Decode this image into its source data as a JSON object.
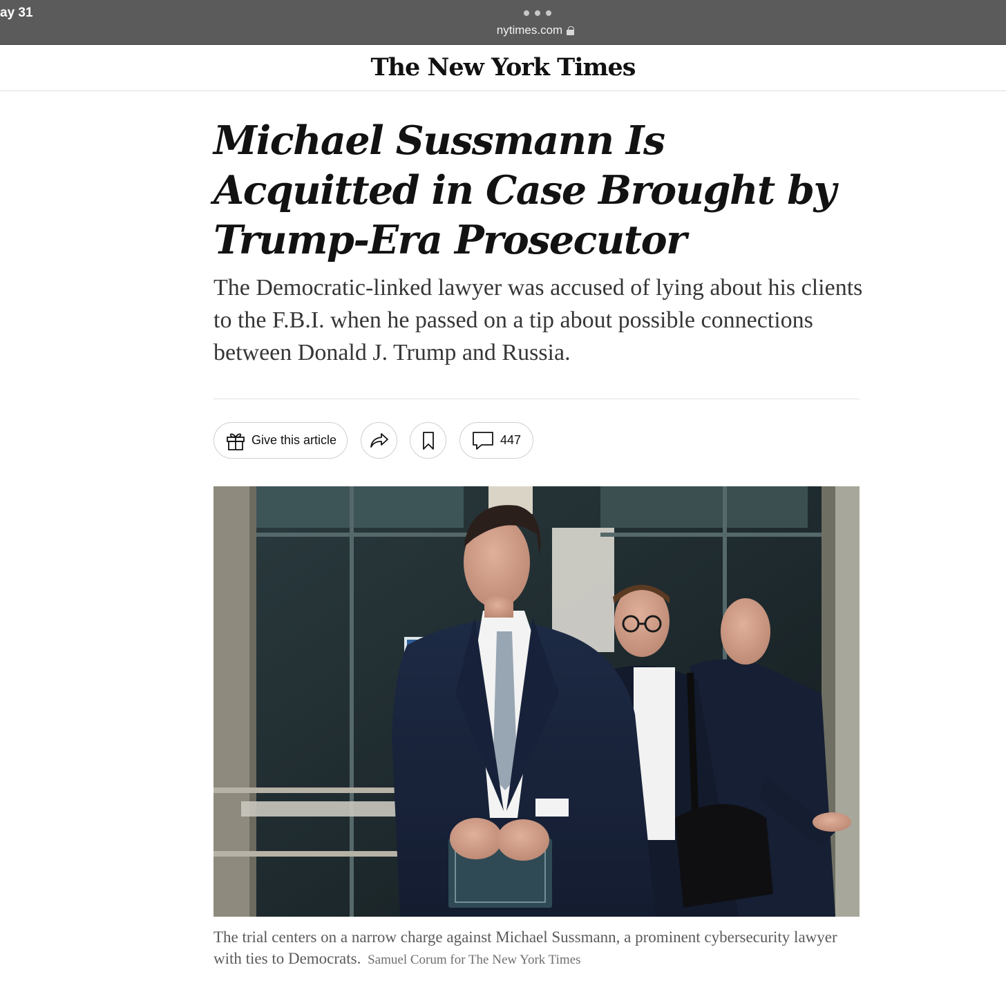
{
  "status_bar": {
    "time": "ay 31",
    "url": "nytimes.com"
  },
  "masthead": {
    "logo_text": "The New York Times"
  },
  "article": {
    "headline": "Michael Sussmann Is Acquitted in Case Brought by Trump-Era Prosecutor",
    "summary": "The Democratic-linked lawyer was accused of lying about his clients to the F.B.I. when he passed on a tip about possible connections between Donald J. Trump and Russia."
  },
  "actions": {
    "give_label": "Give this article",
    "comment_count": "447"
  },
  "photo": {
    "caption": "The trial centers on a narrow charge against Michael Sussmann, a prominent cybersecurity lawyer with ties to Democrats.",
    "credit": "Samuel Corum for The New York Times"
  },
  "icons": [
    "lock-icon",
    "gift-icon",
    "share-icon",
    "bookmark-icon",
    "comment-icon"
  ]
}
